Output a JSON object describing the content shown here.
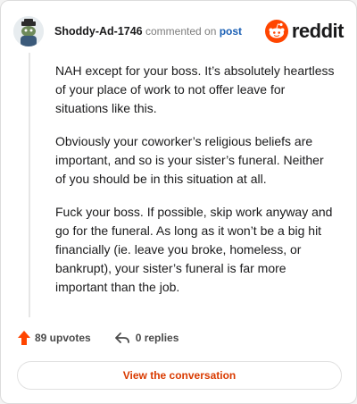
{
  "comment": {
    "author": "Shoddy-Ad-1746",
    "action_text": "commented on",
    "target_text": "post",
    "paragraphs": [
      "NAH except for your boss. It’s absolutely heartless of your place of work to not offer leave for situations like this.",
      "Obviously your coworker’s religious beliefs are important, and so is your sister’s funeral. Neither of you should be in this situation at all.",
      "Fuck your boss. If possible, skip work anyway and go for the funeral. As long as it won’t be a big hit financially (ie. leave you broke, homeless, or bankrupt), your sister’s funeral is far more important than the job."
    ]
  },
  "brand": {
    "name": "reddit",
    "color": "#ff4500"
  },
  "footer": {
    "upvotes_label": "89 upvotes",
    "replies_label": "0 replies",
    "upvote_icon": "upvote-arrow-icon",
    "reply_icon": "reply-arrow-icon"
  },
  "cta": {
    "label": "View the conversation"
  },
  "colors": {
    "accent": "#d93a00",
    "link": "#1a5fb4"
  }
}
